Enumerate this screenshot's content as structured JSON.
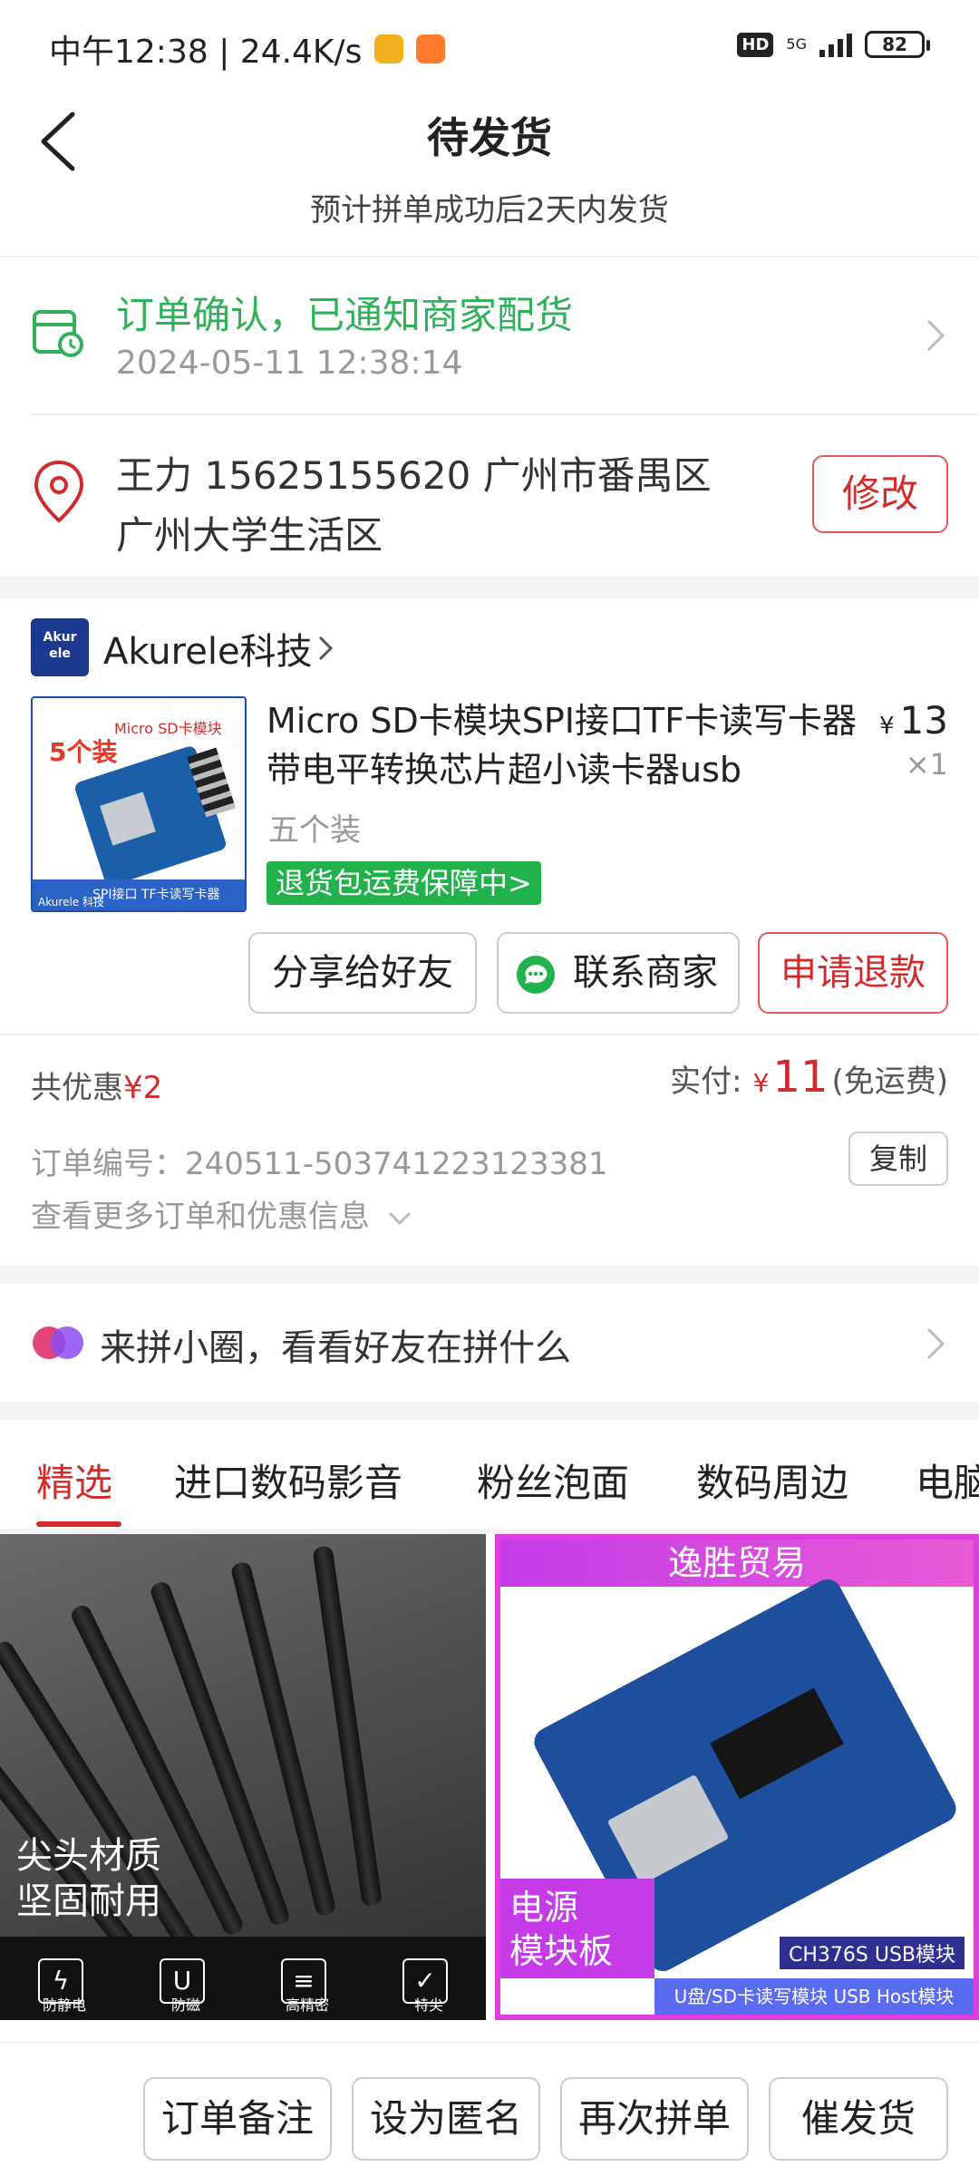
{
  "status_bar": {
    "time_speed": "中午12:38 | 24.4K/s",
    "hd": "HD",
    "network": "5G",
    "battery": "82"
  },
  "header": {
    "title": "待发货",
    "subtitle": "预计拼单成功后2天内发货"
  },
  "order_status": {
    "title": "订单确认，已通知商家配货",
    "time": "2024-05-11 12:38:14"
  },
  "address": {
    "line1": "王力  15625155620  广州市番禺区",
    "line2": "广州大学生活区",
    "edit_label": "修改"
  },
  "shop": {
    "logo_text": "Akur ele",
    "name": "Akurele科技"
  },
  "product": {
    "title": "Micro SD卡模块SPI接口TF卡读写卡器带电平转换芯片超小读卡器usb",
    "price_symbol": "¥",
    "price": "13",
    "qty": "×1",
    "spec": "五个装",
    "guarantee": "退货包运费保障中>",
    "thumb_count": "5个装",
    "thumb_title": "Micro SD卡模块",
    "thumb_footer": "SPI接口 TF卡读写卡器",
    "thumb_brand": "Akurele 科技"
  },
  "actions": {
    "share": "分享给好友",
    "contact": "联系商家",
    "refund": "申请退款"
  },
  "summary": {
    "discount_label": "共优惠",
    "discount_value": "¥2",
    "paid_label": "实付:",
    "paid_symbol": "¥",
    "paid_amount": "11",
    "paid_note": "(免运费)",
    "order_no": "订单编号：240511-503741223123381",
    "copy_label": "复制",
    "more_info": "查看更多订单和优惠信息"
  },
  "circle": {
    "text": "来拼小圈，看看好友在拼什么"
  },
  "tabs": [
    "精选",
    "进口数码影音",
    "粉丝泡面",
    "数码周边",
    "电脑"
  ],
  "feed": {
    "item1": {
      "overlay": "尖头材质\n坚固耐用",
      "line1": "尖头材质",
      "line2": "坚固耐用",
      "features": [
        "防静电",
        "防磁",
        "高精密",
        "特尖"
      ],
      "icons": [
        "ϟ",
        "U",
        "≡",
        "✓"
      ]
    },
    "item2": {
      "banner": "逸胜贸易",
      "label": "电源模块板",
      "label_line1": "电源",
      "label_line2": "模块板",
      "chip": "CH376S USB模块",
      "footer": "U盘/SD卡读写模块 USB Host模块"
    }
  },
  "bottom_bar": {
    "note": "订单备注",
    "anonymous": "设为匿名",
    "regroup": "再次拼单",
    "urge": "催发货"
  }
}
